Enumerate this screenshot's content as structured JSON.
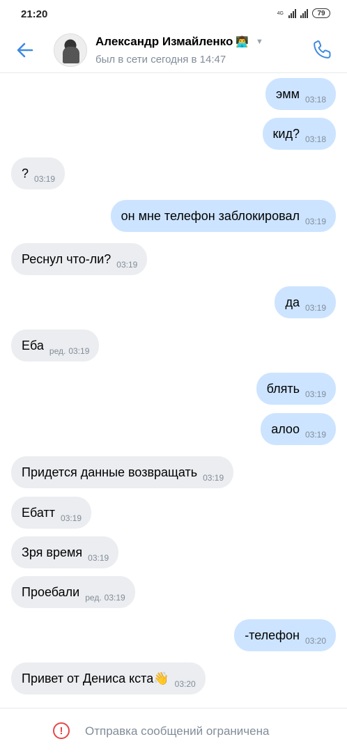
{
  "status_bar": {
    "time": "21:20",
    "network": "4G",
    "battery": "79"
  },
  "header": {
    "name": "Александр Измайленко",
    "name_emoji": "👨‍💻",
    "status": "был в сети сегодня в 14:47",
    "icons": {
      "back": "back-arrow-icon",
      "call": "phone-icon",
      "expand": "chevron-down-icon"
    },
    "accent_color": "#3f8ae0"
  },
  "messages": [
    {
      "dir": "out",
      "text": "эмм",
      "time": "03:18",
      "edited": ""
    },
    {
      "dir": "out",
      "text": "кид?",
      "time": "03:18",
      "edited": ""
    },
    {
      "dir": "in",
      "text": "?",
      "time": "03:19",
      "edited": ""
    },
    {
      "dir": "out",
      "text": "он мне телефон заблокировал",
      "time": "03:19",
      "edited": ""
    },
    {
      "dir": "in",
      "text": "Реснул что-ли?",
      "time": "03:19",
      "edited": ""
    },
    {
      "dir": "out",
      "text": "да",
      "time": "03:19",
      "edited": ""
    },
    {
      "dir": "in",
      "text": "Еба",
      "time": "03:19",
      "edited": "ред."
    },
    {
      "dir": "out",
      "text": "блять",
      "time": "03:19",
      "edited": ""
    },
    {
      "dir": "out",
      "text": "алоо",
      "time": "03:19",
      "edited": ""
    },
    {
      "dir": "in",
      "text": "Придется данные возвращать",
      "time": "03:19",
      "edited": ""
    },
    {
      "dir": "in",
      "text": "Ебатт",
      "time": "03:19",
      "edited": ""
    },
    {
      "dir": "in",
      "text": "Зря время",
      "time": "03:19",
      "edited": ""
    },
    {
      "dir": "in",
      "text": "Проебали",
      "time": "03:19",
      "edited": "ред."
    },
    {
      "dir": "out",
      "text": "-телефон",
      "time": "03:20",
      "edited": ""
    },
    {
      "dir": "in",
      "text": "Привет от Дениса кста👋",
      "time": "03:20",
      "edited": ""
    }
  ],
  "footer": {
    "text": "Отправка сообщений ограничена",
    "icon": "warning-icon",
    "warning_color": "#e64646"
  },
  "colors": {
    "incoming_bubble": "#ebedf0",
    "outgoing_bubble": "#cce4ff",
    "secondary_text": "#818c99"
  }
}
